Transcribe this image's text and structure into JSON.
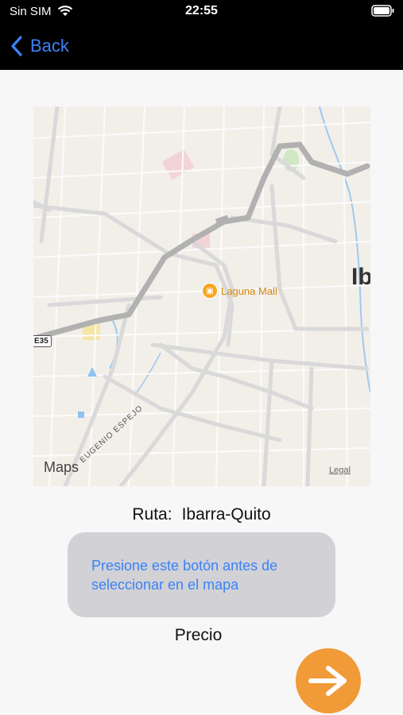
{
  "status_bar": {
    "carrier": "Sin SIM",
    "time": "22:55"
  },
  "nav": {
    "back_label": "Back"
  },
  "map": {
    "poi_label": "Laguna Mall",
    "city_label": "Ib",
    "highway": "E35",
    "street": "EUGENIO ESPEJO",
    "provider": "Maps",
    "legal": "Legal"
  },
  "route": {
    "label": "Ruta:",
    "value": "Ibarra-Quito"
  },
  "select_button": {
    "label": "Presione este botón antes de seleccionar en el mapa"
  },
  "price": {
    "label": "Precio"
  },
  "colors": {
    "accent": "#3b82f6",
    "next_button": "#f19a38",
    "button_bg": "#d1d1d6"
  }
}
